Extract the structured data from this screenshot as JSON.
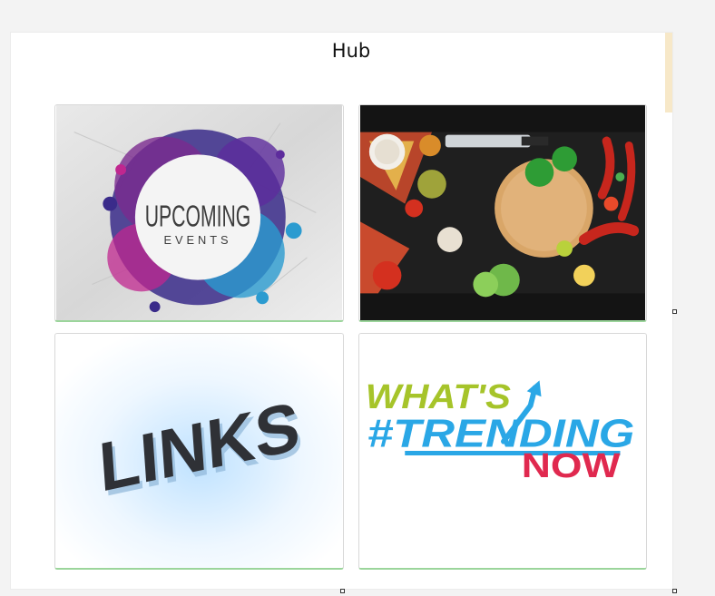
{
  "hub": {
    "title": "Hub"
  },
  "cards": [
    {
      "name": "Upcoming Events",
      "line1": "UPCOMING",
      "line2": "EVENTS"
    },
    {
      "name": "Food"
    },
    {
      "name": "Links",
      "text": "LINKS"
    },
    {
      "name": "What's Trending Now",
      "line1": "WHAT'S",
      "line2": "#TRENDING",
      "line3": "NOW"
    }
  ],
  "colors": {
    "accent_green": "#9bd59b",
    "trending_green": "#a6c42a",
    "trending_blue": "#2aa7e6",
    "trending_red": "#e0294f"
  }
}
